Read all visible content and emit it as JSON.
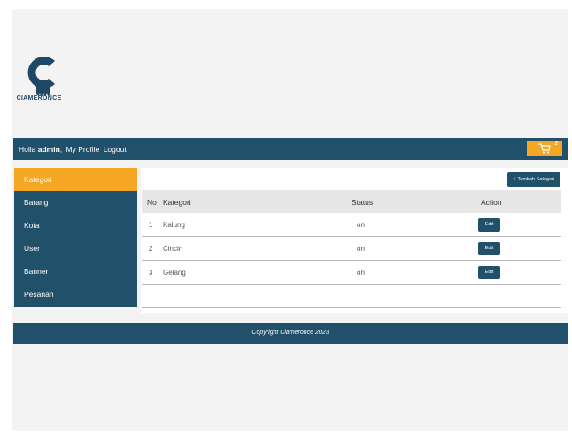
{
  "brand": {
    "name": "CIAMERONCE"
  },
  "topbar": {
    "greeting": "Holla",
    "user": "admin",
    "comma": ",",
    "profile_link": "My Profile",
    "logout_link": "Logout",
    "cart_count": "2"
  },
  "sidebar": {
    "items": [
      {
        "label": "Kategori"
      },
      {
        "label": "Barang"
      },
      {
        "label": "Kota"
      },
      {
        "label": "User"
      },
      {
        "label": "Banner"
      },
      {
        "label": "Pesanan"
      }
    ]
  },
  "content": {
    "add_button": "+ Tambah Kategori",
    "columns": {
      "no": "No",
      "kategori": "Kategori",
      "status": "Status",
      "action": "Action"
    },
    "rows": [
      {
        "no": "1",
        "kategori": "Kalung",
        "status": "on",
        "action": "Edit"
      },
      {
        "no": "2",
        "kategori": "Cincin",
        "status": "on",
        "action": "Edit"
      },
      {
        "no": "3",
        "kategori": "Gelang",
        "status": "on",
        "action": "Edit"
      }
    ]
  },
  "footer": {
    "text": "Copyright Ciameronce 2023"
  },
  "colors": {
    "primary": "#21506b",
    "accent": "#f5a623",
    "background": "#f3f3f3"
  },
  "icons": {
    "cart": "cart-icon",
    "logo": "logo-icon"
  }
}
